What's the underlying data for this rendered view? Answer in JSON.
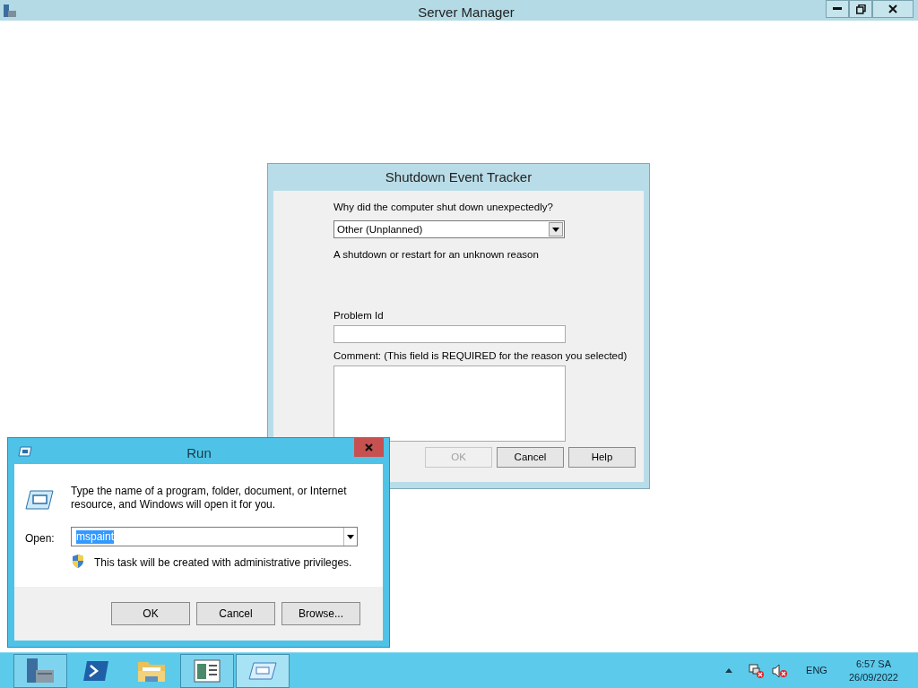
{
  "window": {
    "title": "Server Manager"
  },
  "shutdown_dialog": {
    "title": "Shutdown Event Tracker",
    "question": "Why did the computer shut down unexpectedly?",
    "reason": {
      "value": "Other (Unplanned)"
    },
    "description": "A shutdown or restart for an unknown reason",
    "problem_id": {
      "label": "Problem Id"
    },
    "comment": {
      "label": "Comment: (This field is REQUIRED for the reason you selected)"
    },
    "buttons": [
      {
        "label": "OK",
        "disabled": true
      },
      {
        "label": "Cancel",
        "disabled": false
      },
      {
        "label": "Help",
        "disabled": false
      }
    ]
  },
  "run_dialog": {
    "title": "Run",
    "message": "Type the name of a program, folder, document, or Internet resource, and Windows will open it for you.",
    "open": {
      "label": "Open:",
      "value": "mspaint",
      "selected": true
    },
    "admin_note": "This task will be created with administrative privileges.",
    "buttons": [
      {
        "label": "OK",
        "disabled": false
      },
      {
        "label": "Cancel",
        "disabled": false
      },
      {
        "label": "Browse...",
        "disabled": false
      }
    ]
  },
  "taskbar": {
    "items": [
      {
        "kind": "server",
        "running": true,
        "active": false
      },
      {
        "kind": "powershell",
        "running": false,
        "active": false
      },
      {
        "kind": "folder",
        "running": false,
        "active": false
      },
      {
        "kind": "tracker",
        "running": true,
        "active": false
      },
      {
        "kind": "run",
        "running": true,
        "active": true
      }
    ],
    "language": "ENG",
    "time": "6:57 SA",
    "date": "26/09/2022"
  }
}
